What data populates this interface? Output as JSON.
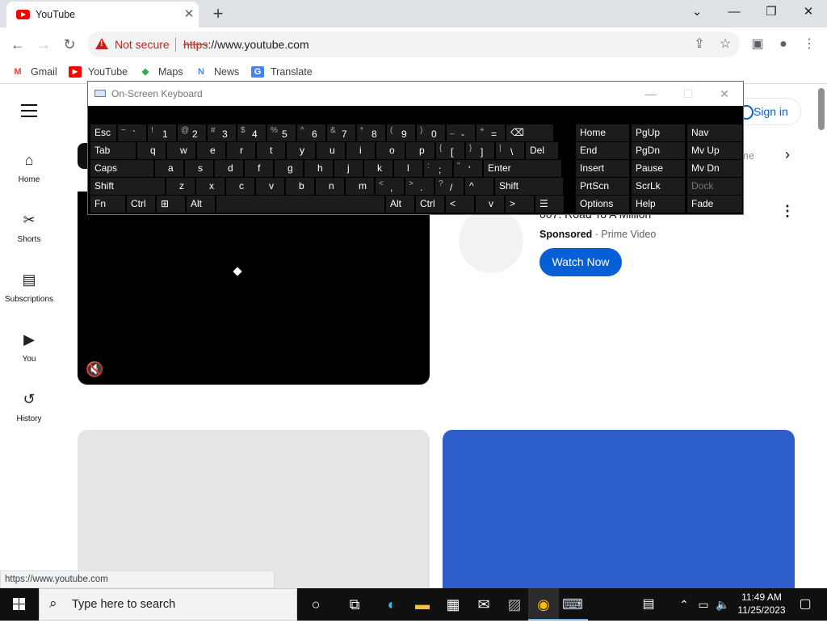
{
  "browser": {
    "tab_title": "YouTube",
    "tab_close": "✕",
    "new_tab": "+",
    "window_controls": {
      "chevron": "⌄",
      "minimize": "—",
      "restore": "❐",
      "close": "✕"
    },
    "security_text": "Not secure",
    "url_scheme": "https",
    "url_rest": "://www.youtube.com",
    "bookmarks": [
      {
        "label": "Gmail",
        "icon": "gmail-icon",
        "icon_color": "#ea4335",
        "glyph": "M"
      },
      {
        "label": "YouTube",
        "icon": "youtube-icon",
        "icon_color": "#ff0000",
        "glyph": "▶"
      },
      {
        "label": "Maps",
        "icon": "maps-icon",
        "icon_color": "#34a853",
        "glyph": "◆"
      },
      {
        "label": "News",
        "icon": "news-icon",
        "icon_color": "#4285f4",
        "glyph": "N"
      },
      {
        "label": "Translate",
        "icon": "translate-icon",
        "icon_color": "#4285f4",
        "glyph": "G"
      }
    ],
    "status_url": "https://www.youtube.com"
  },
  "youtube": {
    "sidebar": [
      {
        "label": "Home",
        "icon": "home-icon",
        "glyph": "⌂"
      },
      {
        "label": "Shorts",
        "icon": "shorts-icon",
        "glyph": "✂"
      },
      {
        "label": "Subscriptions",
        "icon": "subscriptions-icon",
        "glyph": "▤"
      },
      {
        "label": "You",
        "icon": "you-icon",
        "glyph": "▶"
      },
      {
        "label": "History",
        "icon": "history-icon",
        "glyph": "↺"
      }
    ],
    "sign_in": "Sign in",
    "chip_partial": "me",
    "ad": {
      "title": "007: Road To A Million",
      "sponsored": "Sponsored",
      "advertiser": "Prime Video",
      "cta": "Watch Now"
    }
  },
  "osk": {
    "title": "On-Screen Keyboard",
    "rows": [
      [
        [
          "Esc",
          ""
        ],
        [
          "`",
          "~"
        ],
        [
          "1",
          "!"
        ],
        [
          "2",
          "@"
        ],
        [
          "3",
          "#"
        ],
        [
          "4",
          "$"
        ],
        [
          "5",
          "%"
        ],
        [
          "6",
          "^"
        ],
        [
          "7",
          "&"
        ],
        [
          "8",
          "*"
        ],
        [
          "9",
          "("
        ],
        [
          "0",
          ")"
        ],
        [
          "-",
          "_"
        ],
        [
          "=",
          "+"
        ],
        [
          "⌫",
          ""
        ]
      ],
      [
        [
          "Tab",
          ""
        ],
        [
          "q",
          ""
        ],
        [
          "w",
          ""
        ],
        [
          "e",
          ""
        ],
        [
          "r",
          ""
        ],
        [
          "t",
          ""
        ],
        [
          "y",
          ""
        ],
        [
          "u",
          ""
        ],
        [
          "i",
          ""
        ],
        [
          "o",
          ""
        ],
        [
          "p",
          ""
        ],
        [
          "[",
          "{"
        ],
        [
          "]",
          "}"
        ],
        [
          "\\",
          "|"
        ],
        [
          "Del",
          ""
        ]
      ],
      [
        [
          "Caps",
          ""
        ],
        [
          "a",
          ""
        ],
        [
          "s",
          ""
        ],
        [
          "d",
          ""
        ],
        [
          "f",
          ""
        ],
        [
          "g",
          ""
        ],
        [
          "h",
          ""
        ],
        [
          "j",
          ""
        ],
        [
          "k",
          ""
        ],
        [
          "l",
          ""
        ],
        [
          ";",
          ":"
        ],
        [
          "'",
          "\""
        ],
        [
          "Enter",
          ""
        ]
      ],
      [
        [
          "Shift",
          ""
        ],
        [
          "z",
          ""
        ],
        [
          "x",
          ""
        ],
        [
          "c",
          ""
        ],
        [
          "v",
          ""
        ],
        [
          "b",
          ""
        ],
        [
          "n",
          ""
        ],
        [
          "m",
          ""
        ],
        [
          ",",
          "<"
        ],
        [
          ".",
          ">"
        ],
        [
          "/",
          "?"
        ],
        [
          "^",
          ""
        ],
        [
          "Shift",
          ""
        ]
      ],
      [
        [
          "Fn",
          ""
        ],
        [
          "Ctrl",
          ""
        ],
        [
          "⊞",
          ""
        ],
        [
          "Alt",
          ""
        ],
        [
          "",
          ""
        ],
        [
          "Alt",
          ""
        ],
        [
          "Ctrl",
          ""
        ],
        [
          "<",
          ""
        ],
        [
          "v",
          ""
        ],
        [
          ">",
          ""
        ],
        [
          "☰",
          ""
        ]
      ]
    ],
    "nav_keys": [
      [
        "Home",
        "PgUp",
        "Nav"
      ],
      [
        "End",
        "PgDn",
        "Mv Up"
      ],
      [
        "Insert",
        "Pause",
        "Mv Dn"
      ],
      [
        "PrtScn",
        "ScrLk",
        "Dock"
      ],
      [
        "Options",
        "Help",
        "Fade"
      ]
    ]
  },
  "taskbar": {
    "search_placeholder": "Type here to search",
    "time": "11:49 AM",
    "date": "11/25/2023"
  }
}
